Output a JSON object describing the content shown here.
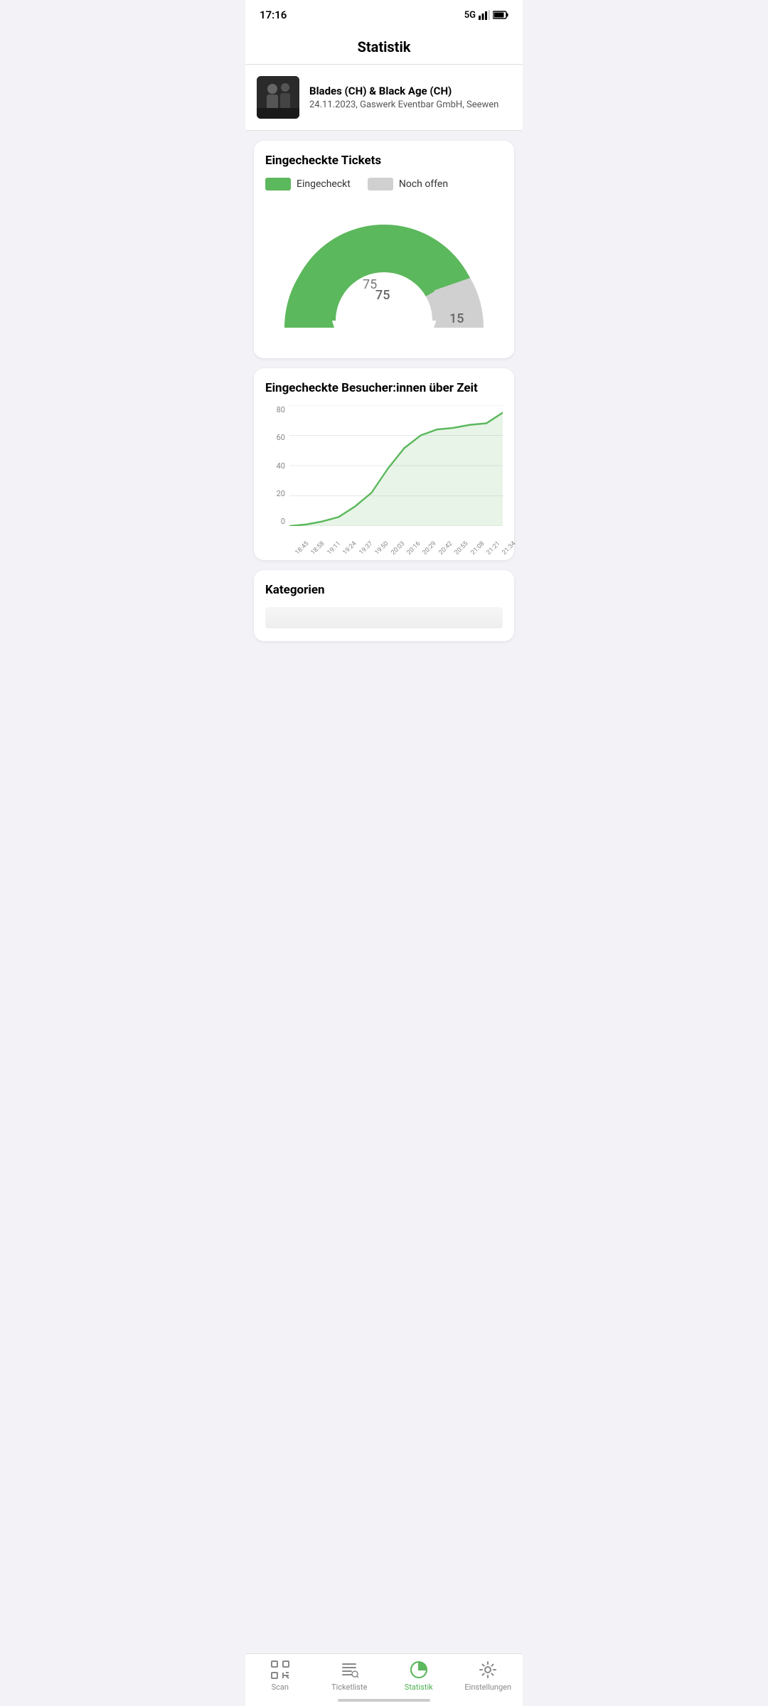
{
  "statusBar": {
    "time": "17:16",
    "network": "5G",
    "signal": "▲",
    "battery": "🔋"
  },
  "header": {
    "title": "Statistik"
  },
  "event": {
    "name": "Blades (CH) & Black Age (CH)",
    "details": "24.11.2023, Gaswerk Eventbar GmbH, Seewen"
  },
  "checkedInCard": {
    "title": "Eingecheckte Tickets",
    "legend": {
      "checkedIn": {
        "label": "Eingecheckt",
        "color": "#5cb85c"
      },
      "stillOpen": {
        "label": "Noch offen",
        "color": "#d0d0d0"
      }
    },
    "checkedInValue": 75,
    "openValue": 15
  },
  "timelineCard": {
    "title": "Eingecheckte Besucher:innen über Zeit",
    "yLabels": [
      "80",
      "60",
      "40",
      "20",
      "0"
    ],
    "xLabels": [
      "18:45",
      "18:58",
      "19:11",
      "19:24",
      "19:37",
      "19:50",
      "20:03",
      "20:16",
      "20:29",
      "20:42",
      "20:55",
      "21:08",
      "21:21",
      "21:34"
    ],
    "lineColor": "#5cb85c",
    "fillColor": "rgba(92,184,92,0.12)"
  },
  "kategorienCard": {
    "title": "Kategorien"
  },
  "bottomNav": {
    "items": [
      {
        "id": "scan",
        "label": "Scan",
        "active": false
      },
      {
        "id": "ticketliste",
        "label": "Ticketliste",
        "active": false
      },
      {
        "id": "statistik",
        "label": "Statistik",
        "active": true
      },
      {
        "id": "einstellungen",
        "label": "Einstellungen",
        "active": false
      }
    ]
  }
}
